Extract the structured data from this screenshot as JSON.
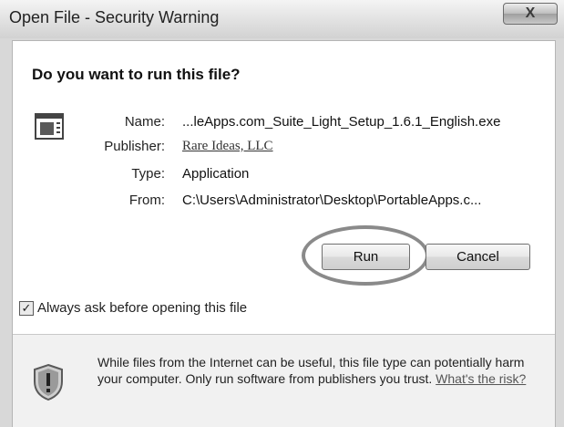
{
  "window": {
    "title": "Open File - Security Warning",
    "close_glyph": "X"
  },
  "main": {
    "question": "Do you want to run this file?",
    "file_icon": "application-window-icon",
    "fields": {
      "name_label": "Name:",
      "name_value": "...leApps.com_Suite_Light_Setup_1.6.1_English.exe",
      "publisher_label": "Publisher:",
      "publisher_value": "Rare Ideas, LLC",
      "type_label": "Type:",
      "type_value": "Application",
      "from_label": "From:",
      "from_value": "C:\\Users\\Administrator\\Desktop\\PortableApps.c..."
    },
    "buttons": {
      "run": "Run",
      "cancel": "Cancel"
    },
    "checkbox": {
      "checked": true,
      "label": "Always ask before opening this file"
    }
  },
  "footer": {
    "warning_icon": "shield-warning-icon",
    "text": "While files from the Internet can be useful, this file type can potentially harm your computer. Only run software from publishers you trust.",
    "link": "What's the risk?"
  }
}
